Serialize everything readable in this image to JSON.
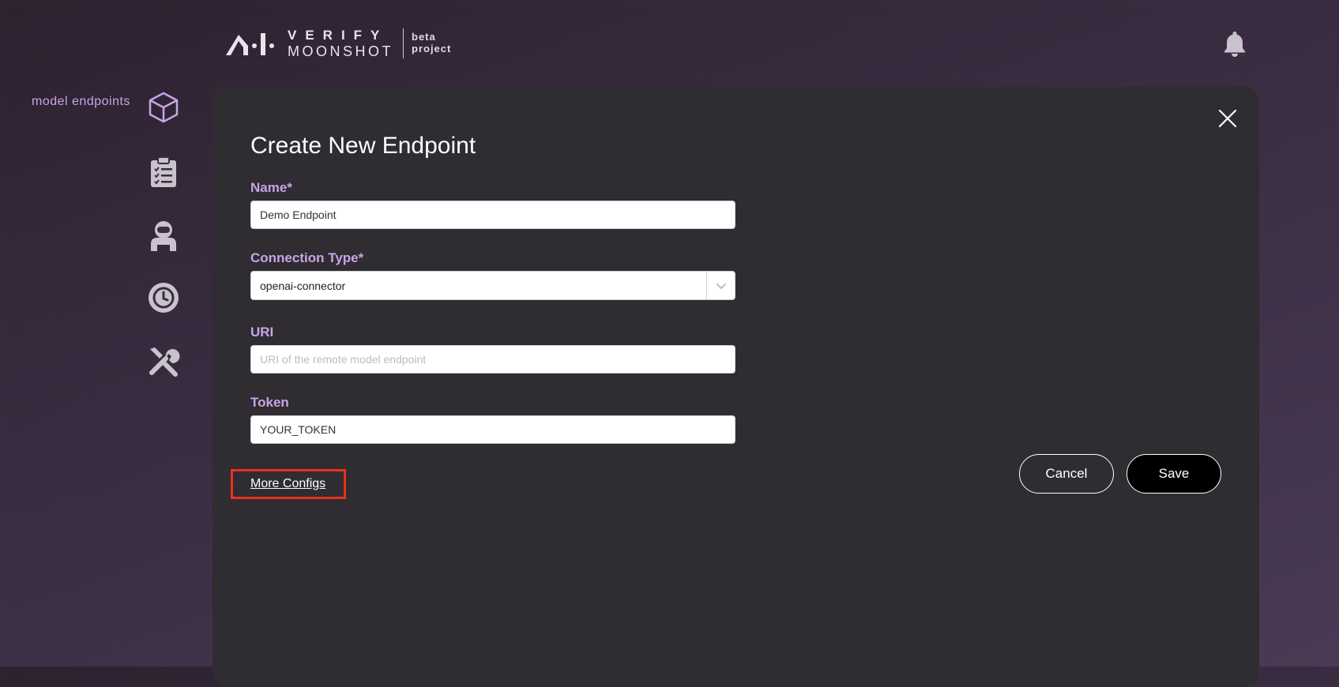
{
  "brand": {
    "line1": "VERIFY",
    "line2": "MOONSHOT",
    "sub1": "beta",
    "sub2": "project"
  },
  "header": {
    "bell_icon": "bell-icon"
  },
  "sidebar": {
    "active_label": "model endpoints",
    "items": [
      {
        "icon": "cube-icon"
      },
      {
        "icon": "clipboard-checklist-icon"
      },
      {
        "icon": "red-teaming-agent-icon"
      },
      {
        "icon": "history-icon"
      },
      {
        "icon": "tools-icon"
      }
    ]
  },
  "modal": {
    "title": "Create New Endpoint",
    "close_icon": "close-icon",
    "fields": {
      "name": {
        "label": "Name*",
        "value": "Demo Endpoint",
        "placeholder": ""
      },
      "connection_type": {
        "label": "Connection Type*",
        "value": "openai-connector"
      },
      "uri": {
        "label": "URI",
        "value": "",
        "placeholder": "URI of the remote model endpoint"
      },
      "token": {
        "label": "Token",
        "value": "YOUR_TOKEN",
        "placeholder": ""
      }
    },
    "more_configs": "More Configs",
    "cancel": "Cancel",
    "save": "Save"
  },
  "colors": {
    "accent_label": "#c9a4e6",
    "modal_bg": "#2f2c32",
    "highlight_box": "#e8331c"
  }
}
